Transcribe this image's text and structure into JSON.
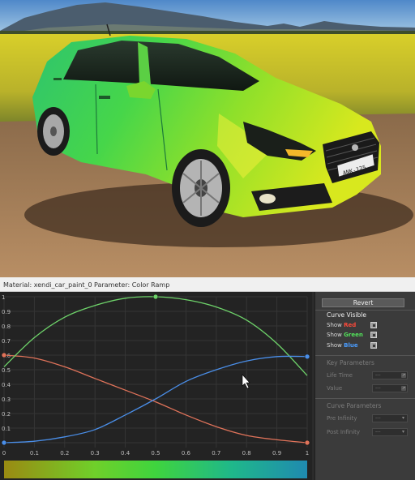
{
  "header": {
    "material": "Material: xendi_car_paint_0",
    "parameter": "Parameter: Color Ramp"
  },
  "scene": {
    "license_plate": "ANK-125"
  },
  "curve_editor": {
    "y_ticks": [
      "1",
      "0.9",
      "0.8",
      "0.7",
      "0.6",
      "0.5",
      "0.4",
      "0.3",
      "0.2",
      "0.1"
    ],
    "x_ticks": [
      "0",
      "0.1",
      "0.2",
      "0.3",
      "0.4",
      "0.5",
      "0.6",
      "0.7",
      "0.8",
      "0.9",
      "1"
    ],
    "colors": {
      "red": "#e0735a",
      "green": "#6ed36a",
      "blue": "#4a8ee8"
    }
  },
  "chart_data": {
    "type": "line",
    "xlim": [
      0,
      1
    ],
    "ylim": [
      0,
      1
    ],
    "grid": true,
    "series": [
      {
        "name": "Red",
        "x": [
          0,
          0.1,
          0.2,
          0.3,
          0.4,
          0.5,
          0.6,
          0.7,
          0.8,
          0.9,
          1.0
        ],
        "values": [
          0.6,
          0.58,
          0.52,
          0.44,
          0.36,
          0.28,
          0.19,
          0.11,
          0.05,
          0.02,
          0.0
        ]
      },
      {
        "name": "Green",
        "x": [
          0,
          0.1,
          0.2,
          0.3,
          0.4,
          0.5,
          0.6,
          0.7,
          0.8,
          0.9,
          1.0
        ],
        "values": [
          0.52,
          0.72,
          0.86,
          0.94,
          0.99,
          1.0,
          0.98,
          0.93,
          0.84,
          0.68,
          0.46
        ]
      },
      {
        "name": "Blue",
        "x": [
          0,
          0.1,
          0.2,
          0.3,
          0.4,
          0.5,
          0.6,
          0.7,
          0.8,
          0.9,
          1.0
        ],
        "values": [
          0.0,
          0.01,
          0.04,
          0.09,
          0.19,
          0.3,
          0.42,
          0.5,
          0.56,
          0.59,
          0.59
        ]
      }
    ],
    "key_points": [
      {
        "series": "Red",
        "x": 0,
        "y": 0.6
      },
      {
        "series": "Red",
        "x": 1,
        "y": 0.0
      },
      {
        "series": "Green",
        "x": 0.5,
        "y": 1.0
      },
      {
        "series": "Blue",
        "x": 0,
        "y": 0.0
      },
      {
        "series": "Blue",
        "x": 1,
        "y": 0.59
      }
    ]
  },
  "panel": {
    "revert_label": "Revert",
    "curve_visible_title": "Curve Visible",
    "show_red_prefix": "Show ",
    "show_red_word": "Red",
    "show_green_prefix": "Show ",
    "show_green_word": "Green",
    "show_blue_prefix": "Show ",
    "show_blue_word": "Blue",
    "key_params_title": "Key Parameters",
    "life_time_label": "Life Time",
    "value_label": "Value",
    "field_placeholder": "---",
    "curve_params_title": "Curve Parameters",
    "pre_infinity_label": "Pre Infinity",
    "post_infinity_label": "Post Infinity",
    "dropdown_placeholder": "---"
  }
}
